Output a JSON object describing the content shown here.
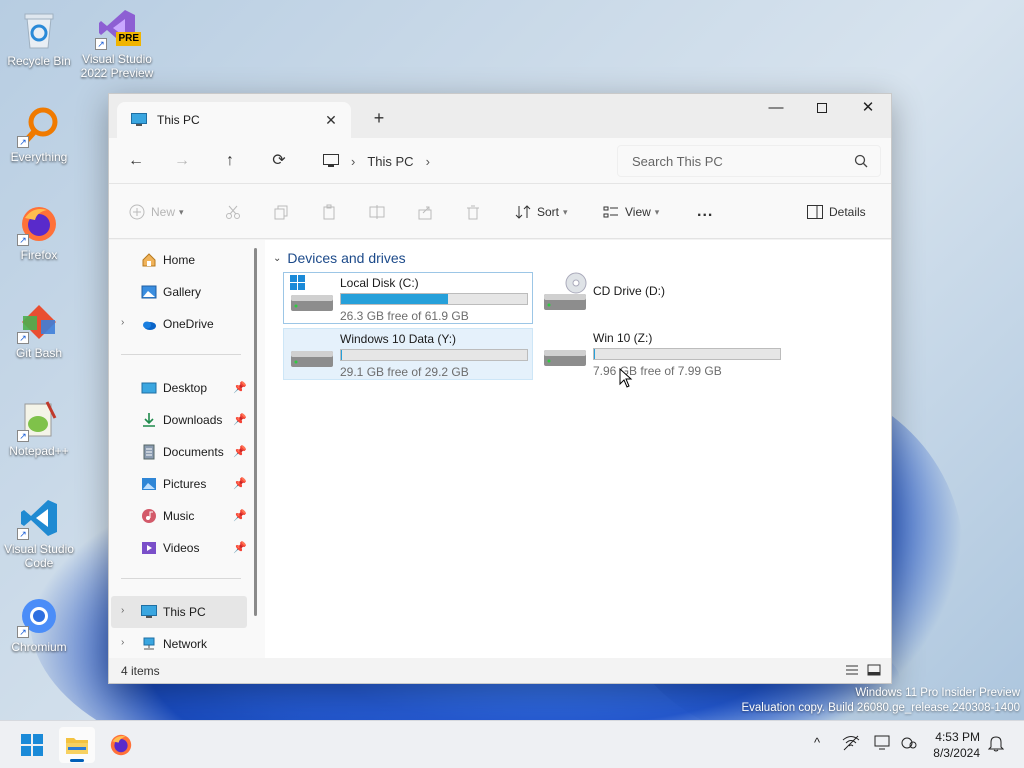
{
  "desktop": {
    "icons": [
      {
        "label": "Recycle Bin"
      },
      {
        "label": "Visual Studio 2022 Preview",
        "badge": "PRE"
      },
      {
        "label": "Everything"
      },
      {
        "label": "Firefox"
      },
      {
        "label": "Git Bash"
      },
      {
        "label": "Notepad++"
      },
      {
        "label": "Visual Studio Code"
      },
      {
        "label": "Chromium"
      }
    ]
  },
  "window": {
    "tab_title": "This PC",
    "address": {
      "location": "This PC"
    },
    "search_placeholder": "Search This PC",
    "toolbar": {
      "new_label": "New",
      "sort_label": "Sort",
      "view_label": "View",
      "more_label": "...",
      "details_label": "Details"
    },
    "sidebar": {
      "items": [
        {
          "label": "Home"
        },
        {
          "label": "Gallery"
        },
        {
          "label": "OneDrive"
        },
        {
          "label": "Desktop"
        },
        {
          "label": "Downloads"
        },
        {
          "label": "Documents"
        },
        {
          "label": "Pictures"
        },
        {
          "label": "Music"
        },
        {
          "label": "Videos"
        },
        {
          "label": "This PC"
        },
        {
          "label": "Network"
        }
      ]
    },
    "content": {
      "group_title": "Devices and drives",
      "drives": [
        {
          "name": "Local Disk (C:)",
          "free_text": "26.3 GB free of 61.9 GB",
          "used_fraction": 0.575
        },
        {
          "name": "CD Drive (D:)"
        },
        {
          "name": "Windows 10 Data (Y:)",
          "free_text": "29.1 GB free of 29.2 GB",
          "used_fraction": 0.003
        },
        {
          "name": "Win 10 (Z:)",
          "free_text": "7.96 GB free of 7.99 GB",
          "used_fraction": 0.004
        }
      ]
    },
    "status": {
      "item_count": "4 items"
    }
  },
  "watermark": {
    "line1": "Windows 11 Pro Insider Preview",
    "line2": "Evaluation copy. Build 26080.ge_release.240308-1400"
  },
  "taskbar": {
    "time": "4:53 PM",
    "date": "8/3/2024"
  },
  "colors": {
    "accent": "#005fb8",
    "drive_bar_fill": "#26a0da",
    "group_header": "#1c4a8a"
  }
}
